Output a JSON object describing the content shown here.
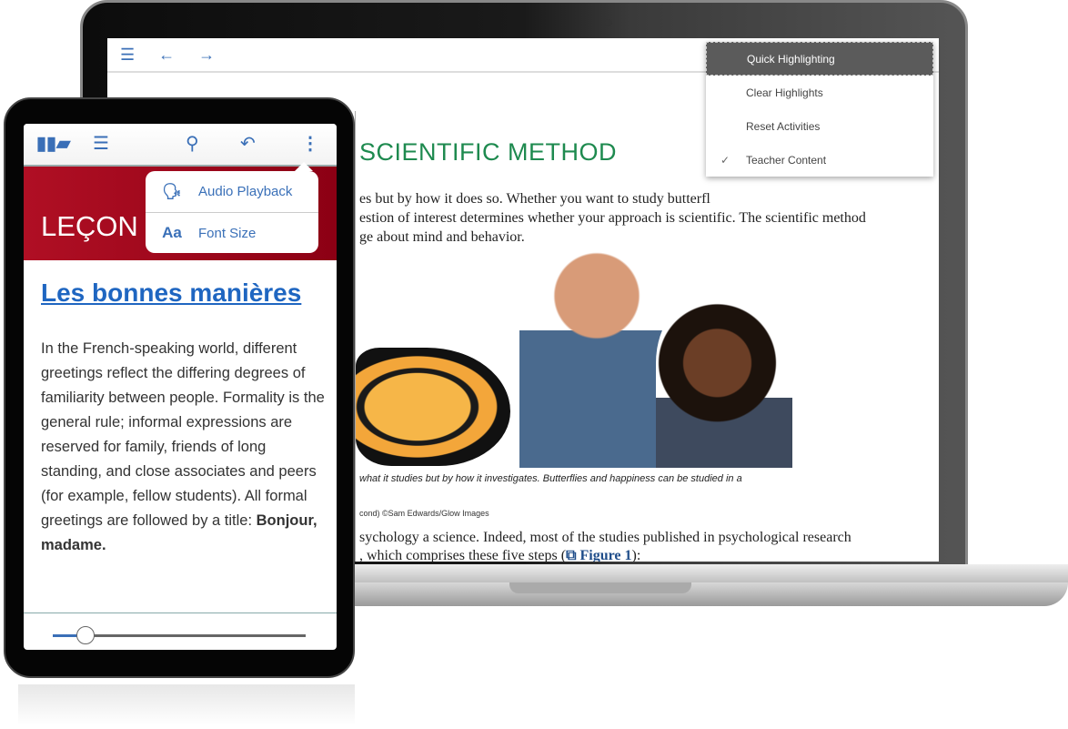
{
  "laptop": {
    "toolbar": {
      "toc_icon": "list-icon",
      "back_icon": "arrow-left-icon",
      "forward_icon": "arrow-right-icon"
    },
    "menu": {
      "items": [
        {
          "label": "Quick Highlighting",
          "active": true
        },
        {
          "label": "Clear Highlights"
        },
        {
          "label": "Reset Activities"
        },
        {
          "label": "Teacher Content",
          "checked": true
        }
      ]
    },
    "content": {
      "title": "SCIENTIFIC METHOD",
      "para_lines": [
        "es but by how it does so. Whether you want to study butterfl",
        "estion of interest determines whether your approach is scientific. The scientific method",
        "ge about mind and behavior."
      ],
      "caption": "what it studies but by how it investigates. Butterflies and happiness can be studied in a",
      "credit": "cond) ©Sam Edwards/Glow Images",
      "para2_line1": "sychology a science. Indeed, most of the studies published in psychological research",
      "para2_line2_pre": ", which comprises these five steps (",
      "figure_link": "Figure 1",
      "para2_line2_post": "):"
    }
  },
  "tablet": {
    "toolbar": {
      "icons": [
        "library-icon",
        "list-icon",
        "search-icon",
        "back-icon",
        "more-vertical-icon"
      ]
    },
    "banner": "LEÇON",
    "popup": [
      {
        "icon": "audio-speaker-icon",
        "label": "Audio Playback"
      },
      {
        "icon": "font-size-icon",
        "icon_text": "Aa",
        "label": "Font Size"
      }
    ],
    "lesson_title": "Les bonnes manières",
    "body": "In the French-speaking world, different greetings reflect the differing degrees of familiarity between people. Formality is the general rule; informal expressions are reserved for family, friends of long standing, and close associates and peers (for example, fellow students). All formal greetings are followed by a title: ",
    "body_bold": "Bonjour, madame.",
    "slider_value": 0.13
  },
  "colors": {
    "accent": "#3a6fb7",
    "title_green": "#1e8a4f",
    "banner_red": "#a50a1e"
  }
}
